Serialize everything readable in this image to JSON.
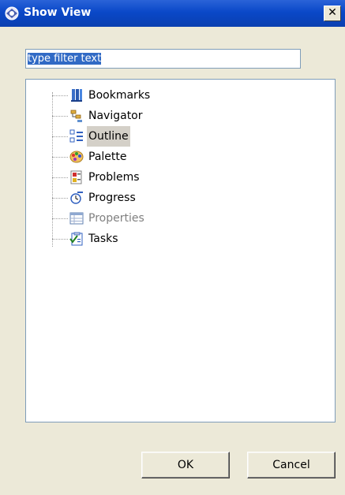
{
  "window": {
    "title": "Show View",
    "close_glyph": "✕"
  },
  "filter": {
    "value": "type filter text"
  },
  "tree": {
    "items": [
      {
        "label": "Bookmarks",
        "icon": "bookmarks-icon"
      },
      {
        "label": "Navigator",
        "icon": "navigator-icon"
      },
      {
        "label": "Outline",
        "icon": "outline-icon",
        "selected": true
      },
      {
        "label": "Palette",
        "icon": "palette-icon"
      },
      {
        "label": "Problems",
        "icon": "problems-icon"
      },
      {
        "label": "Progress",
        "icon": "progress-icon"
      },
      {
        "label": "Properties",
        "icon": "properties-icon",
        "disabled": true
      },
      {
        "label": "Tasks",
        "icon": "tasks-icon"
      }
    ]
  },
  "buttons": {
    "ok": "OK",
    "cancel": "Cancel"
  },
  "colors": {
    "titlebar": "#0a48c8",
    "selection": "#316ac5",
    "dialog_bg": "#ece9d8"
  }
}
